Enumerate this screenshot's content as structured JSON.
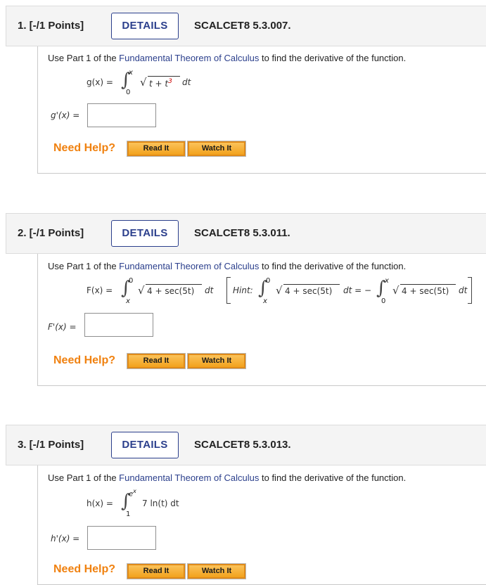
{
  "common": {
    "details_label": "DETAILS",
    "instr_pre": "Use Part 1 of the ",
    "instr_link": "Fundamental Theorem of Calculus",
    "instr_post": " to find the derivative of the function.",
    "need_help": "Need Help?",
    "read_it": "Read It",
    "watch_it": "Watch It"
  },
  "questions": [
    {
      "number": "1. [-/1 Points]",
      "code": "SCALCET8 5.3.007.",
      "fn_lhs": "g(x) =",
      "upper": "x",
      "lower": "0",
      "integrand": "t + t",
      "integrand_exp": "3",
      "dt": "dt",
      "answer_label": "g'(x) =",
      "answer_value": ""
    },
    {
      "number": "2. [-/1 Points]",
      "code": "SCALCET8 5.3.011.",
      "fn_lhs": "F(x) =",
      "upper": "0",
      "lower": "x",
      "integrand": "4 + sec(5t)",
      "dt": "dt",
      "hint_label": "Hint:",
      "hint_upper1": "0",
      "hint_lower1": "x",
      "hint_integrand1": "4 + sec(5t)",
      "hint_mid": "dt = −",
      "hint_upper2": "x",
      "hint_lower2": "0",
      "hint_integrand2": "4 + sec(5t)",
      "hint_dt2": "dt",
      "answer_label": "F'(x) =",
      "answer_value": ""
    },
    {
      "number": "3. [-/1 Points]",
      "code": "SCALCET8 5.3.013.",
      "fn_lhs": "h(x) =",
      "upper_base": "e",
      "upper_exp": "x",
      "lower": "1",
      "integrand": "7 ln(t) dt",
      "answer_label": "h'(x) =",
      "answer_value": ""
    }
  ]
}
